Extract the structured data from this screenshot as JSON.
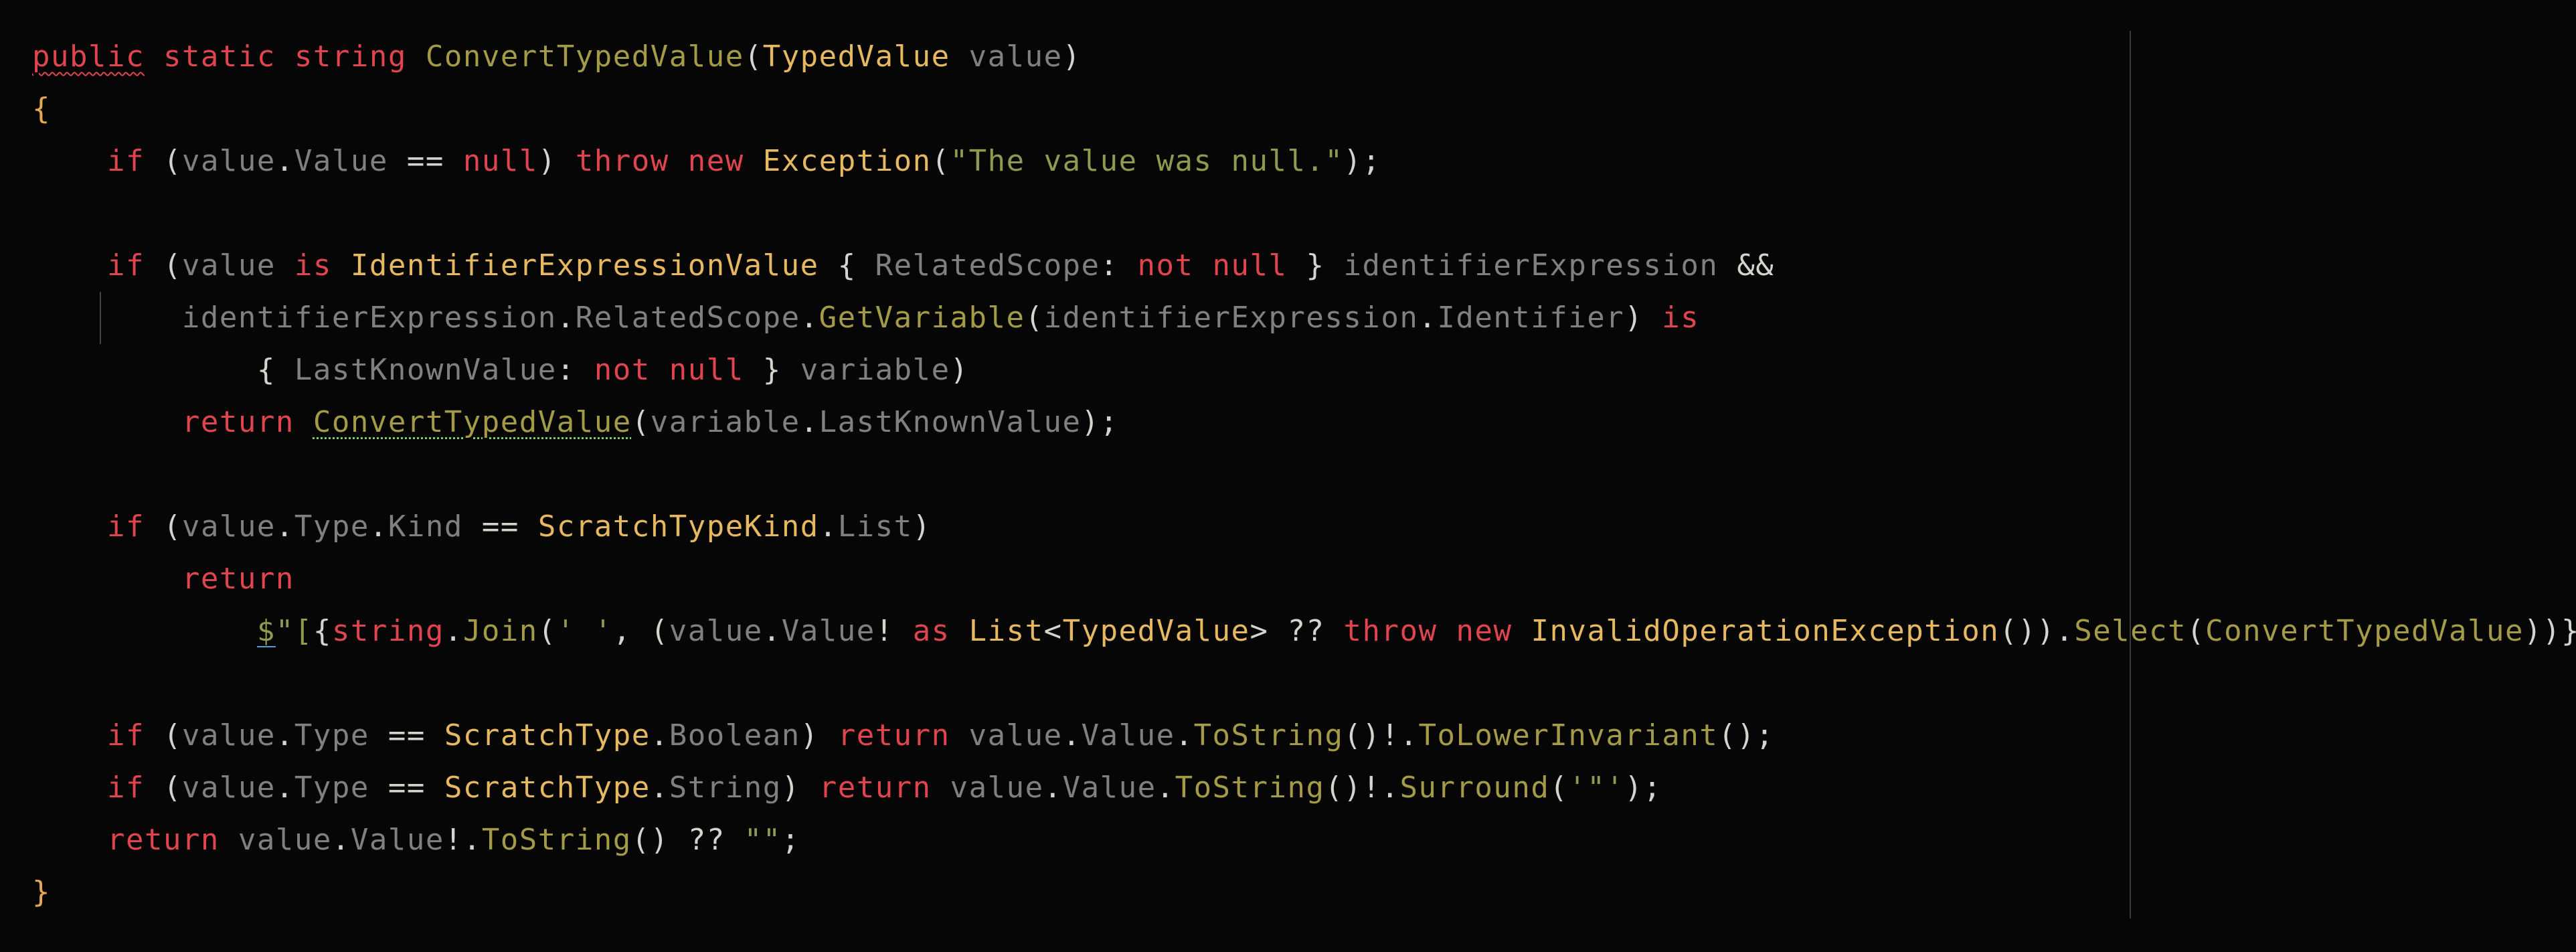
{
  "editor": {
    "language": "C#",
    "lines": [
      [
        [
          "kw squiggle-red",
          "public"
        ],
        [
          "plain",
          " "
        ],
        [
          "kw",
          "static"
        ],
        [
          "plain",
          " "
        ],
        [
          "kw",
          "string"
        ],
        [
          "plain",
          " "
        ],
        [
          "method",
          "ConvertTypedValue"
        ],
        [
          "punct",
          "("
        ],
        [
          "type",
          "TypedValue"
        ],
        [
          "plain",
          " "
        ],
        [
          "var",
          "value"
        ],
        [
          "punct",
          ")"
        ]
      ],
      [
        [
          "bracket-orange",
          "{"
        ]
      ],
      [
        [
          "plain",
          "    "
        ],
        [
          "kw",
          "if"
        ],
        [
          "plain",
          " "
        ],
        [
          "punct",
          "("
        ],
        [
          "var",
          "value"
        ],
        [
          "punct",
          "."
        ],
        [
          "var",
          "Value"
        ],
        [
          "plain",
          " "
        ],
        [
          "punct",
          "=="
        ],
        [
          "plain",
          " "
        ],
        [
          "kw",
          "null"
        ],
        [
          "punct",
          ")"
        ],
        [
          "plain",
          " "
        ],
        [
          "kw",
          "throw"
        ],
        [
          "plain",
          " "
        ],
        [
          "kw",
          "new"
        ],
        [
          "plain",
          " "
        ],
        [
          "type",
          "Exception"
        ],
        [
          "punct",
          "("
        ],
        [
          "str",
          "\"The value was null.\""
        ],
        [
          "punct",
          ");"
        ]
      ],
      [
        [
          "plain",
          ""
        ]
      ],
      [
        [
          "plain",
          "    "
        ],
        [
          "kw",
          "if"
        ],
        [
          "plain",
          " "
        ],
        [
          "punct",
          "("
        ],
        [
          "var",
          "value"
        ],
        [
          "plain",
          " "
        ],
        [
          "kw",
          "is"
        ],
        [
          "plain",
          " "
        ],
        [
          "type",
          "IdentifierExpressionValue"
        ],
        [
          "plain",
          " "
        ],
        [
          "punct",
          "{"
        ],
        [
          "plain",
          " "
        ],
        [
          "var",
          "RelatedScope"
        ],
        [
          "punct",
          ":"
        ],
        [
          "plain",
          " "
        ],
        [
          "kw",
          "not"
        ],
        [
          "plain",
          " "
        ],
        [
          "kw",
          "null"
        ],
        [
          "plain",
          " "
        ],
        [
          "punct",
          "}"
        ],
        [
          "plain",
          " "
        ],
        [
          "var",
          "identifierExpression"
        ],
        [
          "plain",
          " "
        ],
        [
          "punct",
          "&&"
        ]
      ],
      [
        [
          "plain",
          "        "
        ],
        [
          "var",
          "identifierExpression"
        ],
        [
          "punct",
          "."
        ],
        [
          "var",
          "RelatedScope"
        ],
        [
          "punct",
          "."
        ],
        [
          "method",
          "GetVariable"
        ],
        [
          "punct",
          "("
        ],
        [
          "var",
          "identifierExpression"
        ],
        [
          "punct",
          "."
        ],
        [
          "var",
          "Identifier"
        ],
        [
          "punct",
          ")"
        ],
        [
          "plain",
          " "
        ],
        [
          "kw",
          "is"
        ]
      ],
      [
        [
          "plain",
          "            "
        ],
        [
          "punct",
          "{"
        ],
        [
          "plain",
          " "
        ],
        [
          "var",
          "LastKnownValue"
        ],
        [
          "punct",
          ":"
        ],
        [
          "plain",
          " "
        ],
        [
          "kw",
          "not"
        ],
        [
          "plain",
          " "
        ],
        [
          "kw",
          "null"
        ],
        [
          "plain",
          " "
        ],
        [
          "punct",
          "}"
        ],
        [
          "plain",
          " "
        ],
        [
          "var",
          "variable"
        ],
        [
          "punct",
          ")"
        ]
      ],
      [
        [
          "plain",
          "        "
        ],
        [
          "kw",
          "return"
        ],
        [
          "plain",
          " "
        ],
        [
          "method squiggle-green",
          "ConvertTypedValue"
        ],
        [
          "punct",
          "("
        ],
        [
          "var",
          "variable"
        ],
        [
          "punct",
          "."
        ],
        [
          "var",
          "LastKnownValue"
        ],
        [
          "punct",
          ");"
        ]
      ],
      [
        [
          "plain",
          ""
        ]
      ],
      [
        [
          "plain",
          "    "
        ],
        [
          "kw",
          "if"
        ],
        [
          "plain",
          " "
        ],
        [
          "punct",
          "("
        ],
        [
          "var",
          "value"
        ],
        [
          "punct",
          "."
        ],
        [
          "var",
          "Type"
        ],
        [
          "punct",
          "."
        ],
        [
          "var",
          "Kind"
        ],
        [
          "plain",
          " "
        ],
        [
          "punct",
          "=="
        ],
        [
          "plain",
          " "
        ],
        [
          "type",
          "ScratchTypeKind"
        ],
        [
          "punct",
          "."
        ],
        [
          "var",
          "List"
        ],
        [
          "punct",
          ")"
        ]
      ],
      [
        [
          "plain",
          "        "
        ],
        [
          "kw",
          "return"
        ]
      ],
      [
        [
          "plain",
          "            "
        ],
        [
          "str underline-blue",
          "$"
        ],
        [
          "str",
          "\"["
        ],
        [
          "punct",
          "{"
        ],
        [
          "kw",
          "string"
        ],
        [
          "punct",
          "."
        ],
        [
          "method",
          "Join"
        ],
        [
          "punct",
          "("
        ],
        [
          "str",
          "' '"
        ],
        [
          "punct",
          ","
        ],
        [
          "plain",
          " "
        ],
        [
          "punct",
          "("
        ],
        [
          "var",
          "value"
        ],
        [
          "punct",
          "."
        ],
        [
          "var",
          "Value"
        ],
        [
          "punct",
          "!"
        ],
        [
          "plain",
          " "
        ],
        [
          "kw",
          "as"
        ],
        [
          "plain",
          " "
        ],
        [
          "type",
          "List"
        ],
        [
          "punct",
          "<"
        ],
        [
          "type",
          "TypedValue"
        ],
        [
          "punct",
          ">"
        ],
        [
          "plain",
          " "
        ],
        [
          "punct",
          "??"
        ],
        [
          "plain",
          " "
        ],
        [
          "kw",
          "throw"
        ],
        [
          "plain",
          " "
        ],
        [
          "kw",
          "new"
        ],
        [
          "plain",
          " "
        ],
        [
          "type",
          "InvalidOperationException"
        ],
        [
          "punct",
          "())."
        ],
        [
          "method",
          "Select"
        ],
        [
          "punct",
          "("
        ],
        [
          "method",
          "ConvertTypedValue"
        ],
        [
          "punct",
          "))"
        ],
        [
          "punct",
          "}"
        ],
        [
          "str",
          "]\""
        ],
        [
          "punct",
          ";"
        ]
      ],
      [
        [
          "plain",
          ""
        ]
      ],
      [
        [
          "plain",
          "    "
        ],
        [
          "kw",
          "if"
        ],
        [
          "plain",
          " "
        ],
        [
          "punct",
          "("
        ],
        [
          "var",
          "value"
        ],
        [
          "punct",
          "."
        ],
        [
          "var",
          "Type"
        ],
        [
          "plain",
          " "
        ],
        [
          "punct",
          "=="
        ],
        [
          "plain",
          " "
        ],
        [
          "type",
          "ScratchType"
        ],
        [
          "punct",
          "."
        ],
        [
          "var",
          "Boolean"
        ],
        [
          "punct",
          ")"
        ],
        [
          "plain",
          " "
        ],
        [
          "kw",
          "return"
        ],
        [
          "plain",
          " "
        ],
        [
          "var",
          "value"
        ],
        [
          "punct",
          "."
        ],
        [
          "var",
          "Value"
        ],
        [
          "punct",
          "."
        ],
        [
          "method",
          "ToString"
        ],
        [
          "punct",
          "()!."
        ],
        [
          "method",
          "ToLowerInvariant"
        ],
        [
          "punct",
          "();"
        ]
      ],
      [
        [
          "plain",
          "    "
        ],
        [
          "kw",
          "if"
        ],
        [
          "plain",
          " "
        ],
        [
          "punct",
          "("
        ],
        [
          "var",
          "value"
        ],
        [
          "punct",
          "."
        ],
        [
          "var",
          "Type"
        ],
        [
          "plain",
          " "
        ],
        [
          "punct",
          "=="
        ],
        [
          "plain",
          " "
        ],
        [
          "type",
          "ScratchType"
        ],
        [
          "punct",
          "."
        ],
        [
          "var",
          "String"
        ],
        [
          "punct",
          ")"
        ],
        [
          "plain",
          " "
        ],
        [
          "kw",
          "return"
        ],
        [
          "plain",
          " "
        ],
        [
          "var",
          "value"
        ],
        [
          "punct",
          "."
        ],
        [
          "var",
          "Value"
        ],
        [
          "punct",
          "."
        ],
        [
          "method",
          "ToString"
        ],
        [
          "punct",
          "()!."
        ],
        [
          "method",
          "Surround"
        ],
        [
          "punct",
          "("
        ],
        [
          "str",
          "'\"'"
        ],
        [
          "punct",
          ");"
        ]
      ],
      [
        [
          "plain",
          "    "
        ],
        [
          "kw",
          "return"
        ],
        [
          "plain",
          " "
        ],
        [
          "var",
          "value"
        ],
        [
          "punct",
          "."
        ],
        [
          "var",
          "Value"
        ],
        [
          "punct",
          "!."
        ],
        [
          "method",
          "ToString"
        ],
        [
          "punct",
          "()"
        ],
        [
          "plain",
          " "
        ],
        [
          "punct",
          "??"
        ],
        [
          "plain",
          " "
        ],
        [
          "str",
          "\"\""
        ],
        [
          "punct",
          ";"
        ]
      ],
      [
        [
          "bracket-orange",
          "}"
        ]
      ]
    ]
  }
}
